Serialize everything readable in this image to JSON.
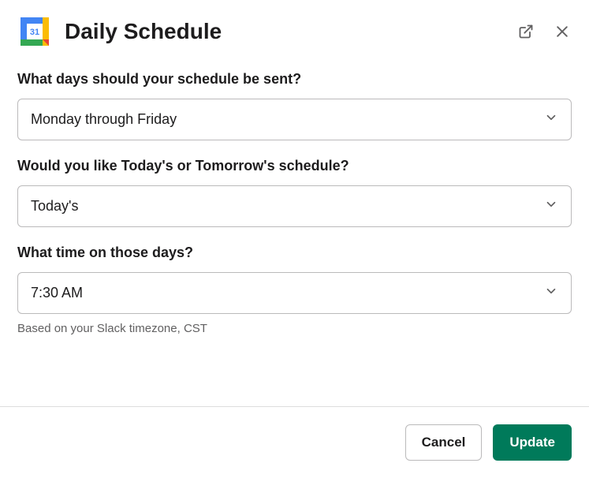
{
  "header": {
    "title": "Daily Schedule",
    "icon_day": "31"
  },
  "fields": {
    "days": {
      "label": "What days should your schedule be sent?",
      "value": "Monday through Friday"
    },
    "day_type": {
      "label": "Would you like Today's or Tomorrow's schedule?",
      "value": "Today's"
    },
    "time": {
      "label": "What time on those days?",
      "value": "7:30 AM",
      "hint": "Based on your Slack timezone, CST"
    }
  },
  "footer": {
    "cancel_label": "Cancel",
    "update_label": "Update"
  }
}
